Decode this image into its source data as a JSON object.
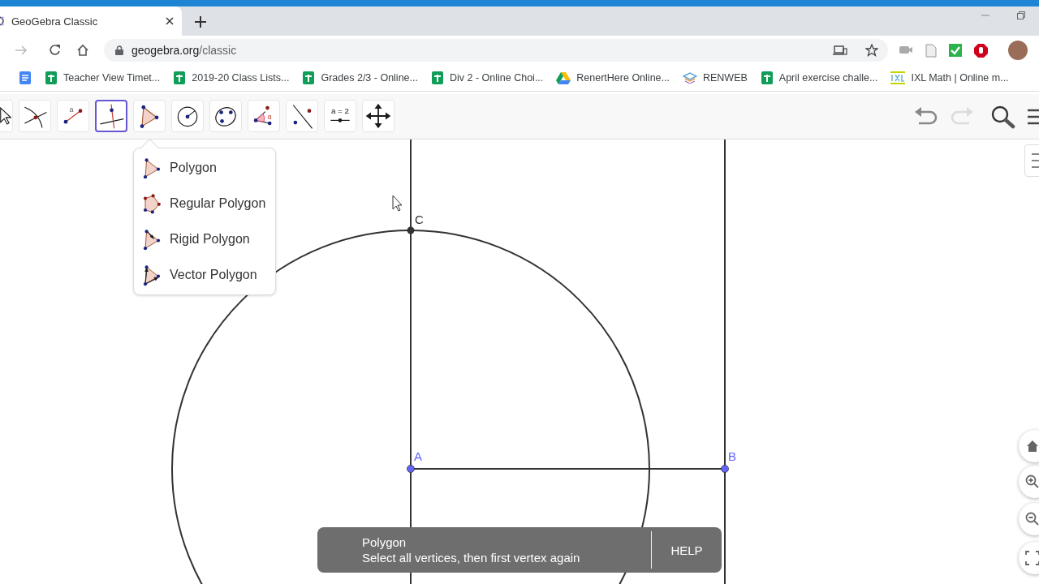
{
  "browser": {
    "tabs": [
      {
        "title": "GeoGebra Classic",
        "selected": true
      }
    ],
    "address": {
      "host": "geogebra.org",
      "path": "/classic"
    },
    "bookmarks": [
      {
        "kind": "docs"
      },
      {
        "label": "Teacher View Timet...",
        "kind": "sheets"
      },
      {
        "label": "2019-20 Class Lists...",
        "kind": "sheets"
      },
      {
        "label": "Grades 2/3 - Online...",
        "kind": "sheets"
      },
      {
        "label": "Div 2 - Online Choi...",
        "kind": "sheets"
      },
      {
        "label": "RenertHere Online...",
        "kind": "drive"
      },
      {
        "label": "RENWEB",
        "kind": "books"
      },
      {
        "label": "April exercise challe...",
        "kind": "sheets"
      },
      {
        "label": "IXL Math | Online m...",
        "kind": "ixl"
      }
    ]
  },
  "toolbar": {
    "tools": [
      {
        "kind": "move",
        "selected": false
      },
      {
        "kind": "intersect",
        "selected": false
      },
      {
        "kind": "segment",
        "glyph": "a",
        "selected": false
      },
      {
        "kind": "perpendicular",
        "selected": true
      },
      {
        "kind": "polygon",
        "selected": false
      },
      {
        "kind": "circle",
        "selected": false
      },
      {
        "kind": "conic",
        "selected": false
      },
      {
        "kind": "angle",
        "glyph": "α",
        "selected": false
      },
      {
        "kind": "reflect",
        "selected": false
      },
      {
        "kind": "slider",
        "glyph": "a = 2",
        "selected": false
      },
      {
        "kind": "pan",
        "selected": false
      }
    ],
    "undo": {
      "disabled": false
    },
    "redo": {
      "disabled": true
    }
  },
  "tool_menu": {
    "items": [
      {
        "label": "Polygon",
        "kind": "polygon"
      },
      {
        "label": "Regular Polygon",
        "kind": "regular"
      },
      {
        "label": "Rigid Polygon",
        "kind": "rigid"
      },
      {
        "label": "Vector Polygon",
        "kind": "vector"
      }
    ]
  },
  "points": [
    {
      "label": "C",
      "color": "#333333"
    },
    {
      "label": "A",
      "color": "#6464ff"
    },
    {
      "label": "B",
      "color": "#6464ff"
    }
  ],
  "toast": {
    "title": "Polygon",
    "text": "Select all vertices, then first vertex again",
    "button": "HELP"
  }
}
